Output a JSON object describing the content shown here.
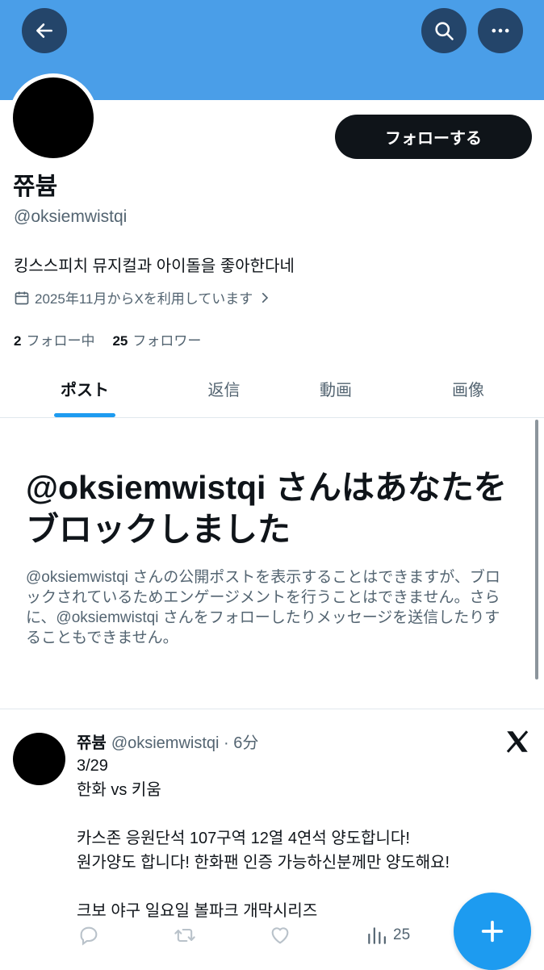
{
  "header": {
    "back_icon": "arrow-left-icon",
    "search_icon": "search-icon",
    "more_icon": "more-horizontal-icon",
    "banner_color": "#4a9ee8"
  },
  "profile": {
    "display_name": "쮸븀",
    "handle": "@oksiemwistqi",
    "bio": "킹스스피치 뮤지컬과 아이돌을 좋아한다네",
    "joined": "2025年11月からXを利用しています",
    "following_count": "2",
    "following_label": "フォロー中",
    "followers_count": "25",
    "followers_label": "フォロワー",
    "follow_button": "フォローする"
  },
  "tabs": [
    {
      "label": "ポスト",
      "active": true
    },
    {
      "label": "返信",
      "active": false
    },
    {
      "label": "動画",
      "active": false
    },
    {
      "label": "画像",
      "active": false
    }
  ],
  "block_notice": {
    "title": "@oksiemwistqi さんはあなたをブロックしました",
    "description": "@oksiemwistqi さんの公開ポストを表示することはできますが、ブロックされているためエンゲージメントを行うことはできません。さらに、@oksiemwistqi さんをフォローしたりメッセージを送信したりすることもできません。"
  },
  "post": {
    "author_name": "쮸븀",
    "author_meta": "@oksiemwistqi · 6分",
    "text": "3/29\n한화 vs 키움\n\n카스존 응원단석 107구역 12열 4연석 양도합니다!\n원가양도 합니다! 한화팬 인증 가능하신분께만 양도해요!\n\n크보 야구 일요일 볼파크 개막시리즈",
    "views": "25"
  },
  "accent_color": "#1d9bf0"
}
